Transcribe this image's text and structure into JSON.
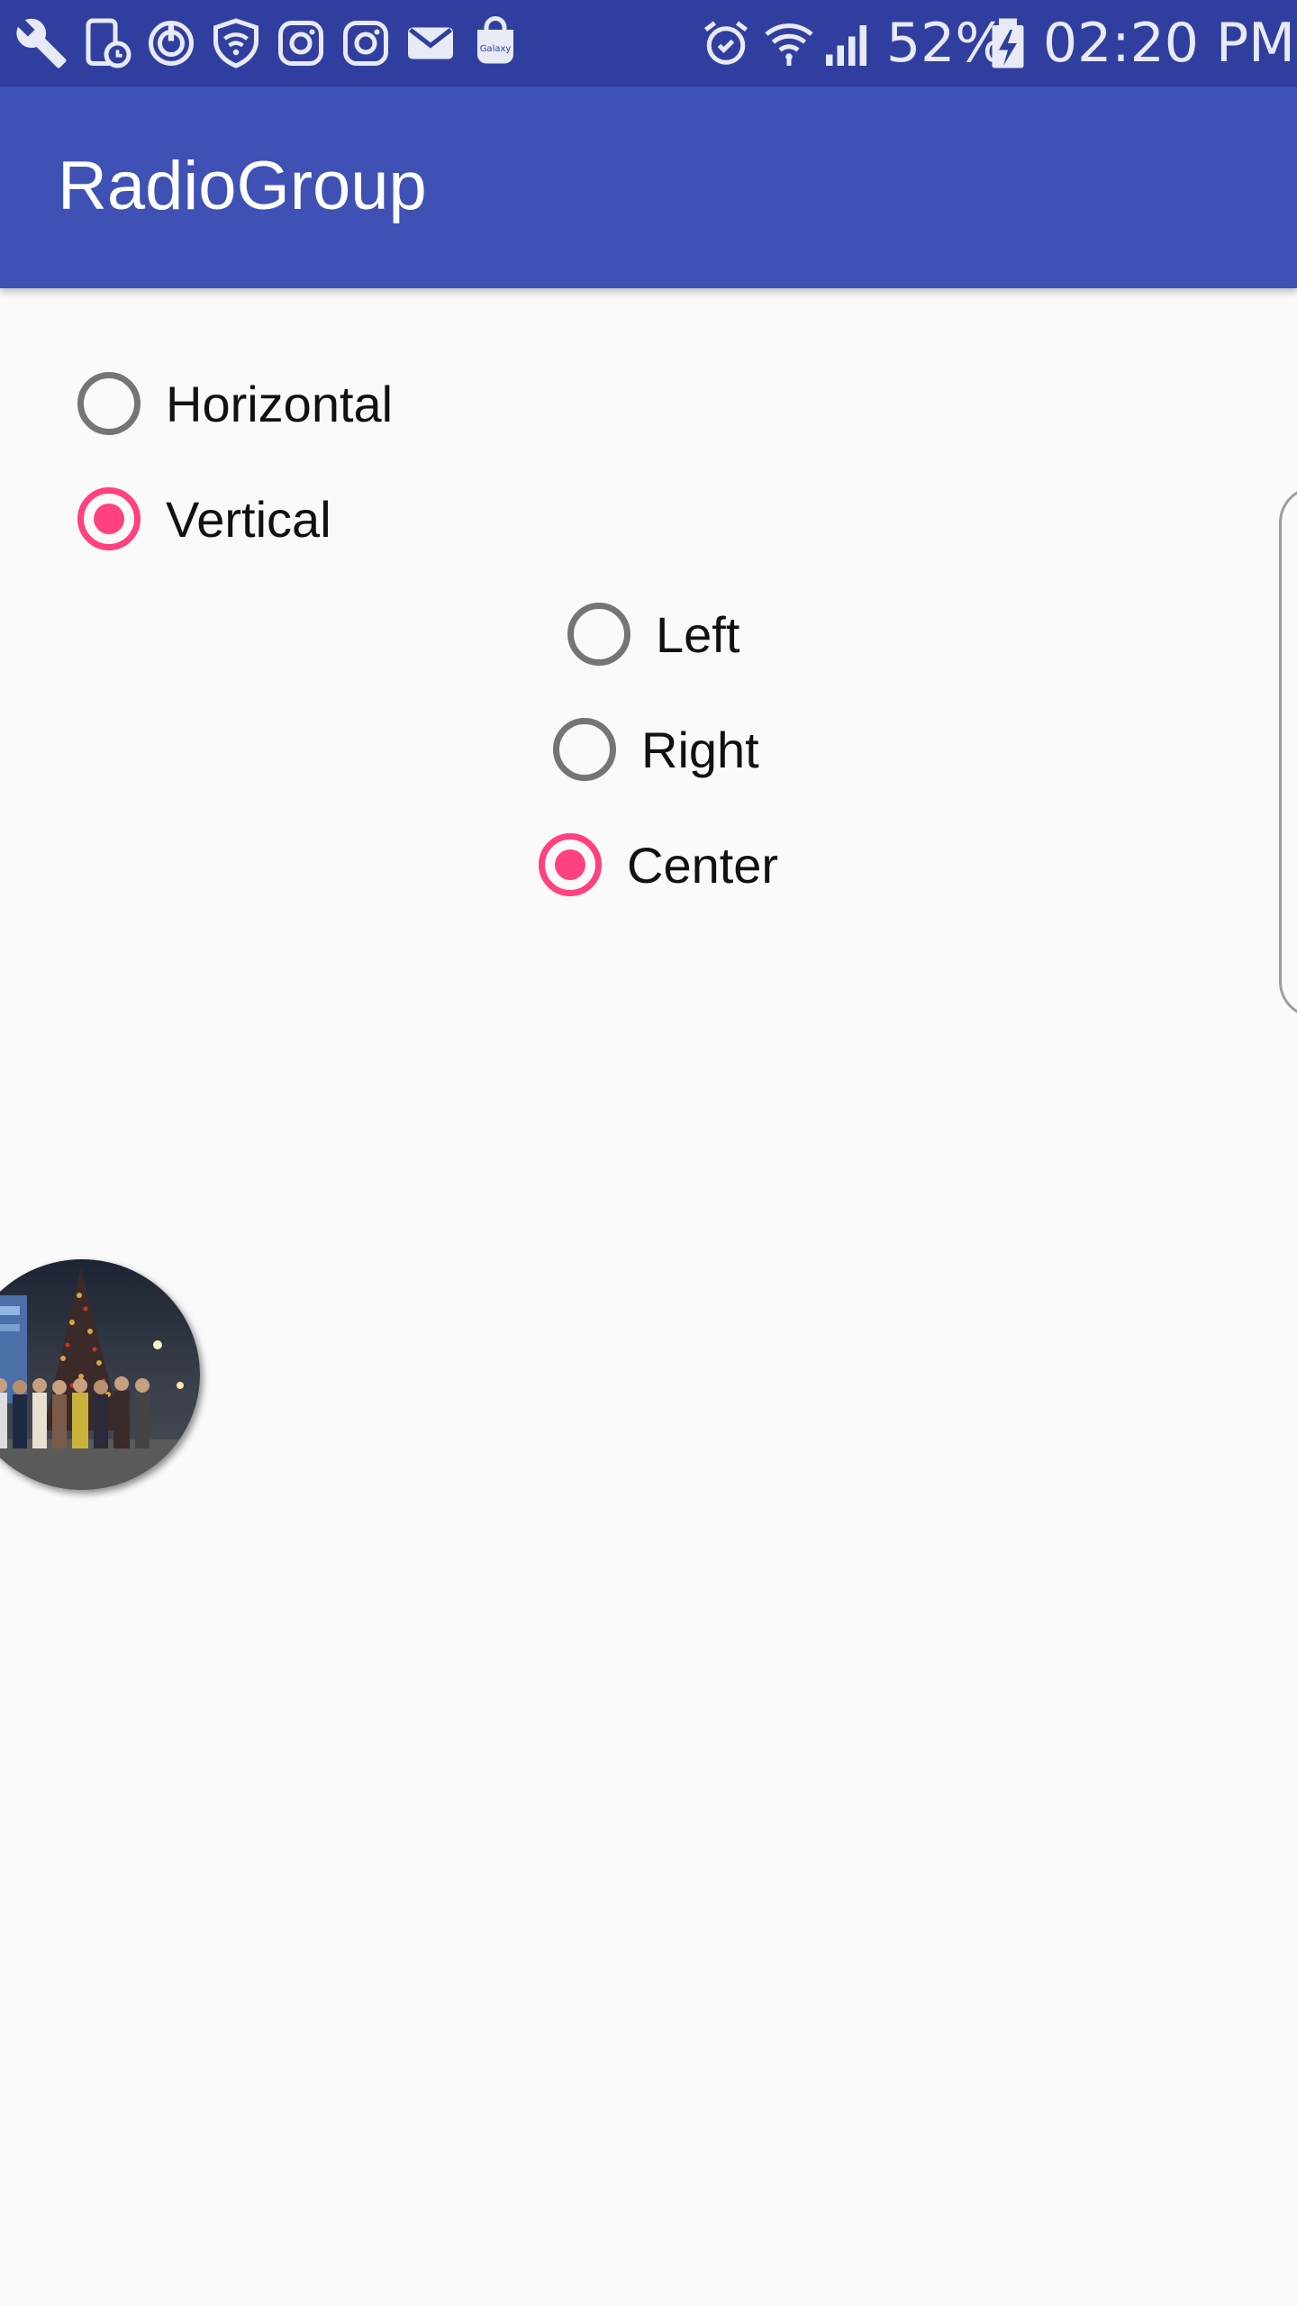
{
  "status_bar": {
    "left_icons": [
      "wrench-icon",
      "phone-clock-icon",
      "power-sync-icon",
      "wifi-shield-icon",
      "instagram-icon",
      "instagram-icon",
      "mail-icon",
      "galaxy-apps-icon"
    ],
    "galaxy_badge": "Galaxy",
    "right_icons": [
      "alarm-icon",
      "wifi-icon",
      "signal-icon"
    ],
    "battery_percent": "52%",
    "battery_icon": "battery-charging-icon",
    "time": "02:20 PM",
    "background": "#303f9f"
  },
  "app_bar": {
    "title": "RadioGroup",
    "background": "#3f51b5"
  },
  "orientation_group": {
    "options": [
      {
        "label": "Horizontal",
        "checked": false
      },
      {
        "label": "Vertical",
        "checked": true
      }
    ]
  },
  "gravity_group": {
    "options": [
      {
        "label": "Left",
        "checked": false
      },
      {
        "label": "Right",
        "checked": false
      },
      {
        "label": "Center",
        "checked": true
      }
    ]
  },
  "colors": {
    "accent": "#ff4081",
    "radio_unchecked": "#757575",
    "background": "#fafafa"
  },
  "image": {
    "description_icon": "group-photo-oval"
  }
}
